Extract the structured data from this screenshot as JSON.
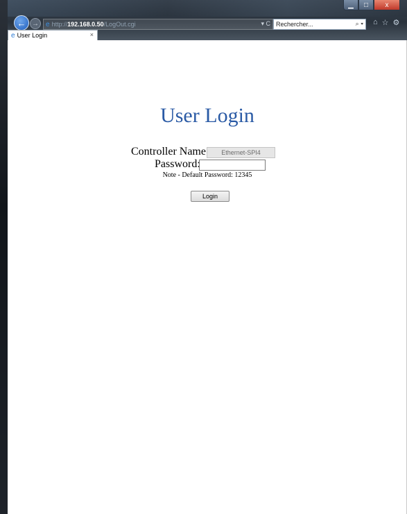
{
  "window": {
    "minimize_glyph": "▁",
    "maximize_glyph": "□",
    "close_glyph": "x"
  },
  "toolbar": {
    "back_glyph": "←",
    "forward_glyph": "→",
    "address_prefix": "http://",
    "address_host": "192.168.0.50",
    "address_path": "/LogOut.cgi",
    "refresh_glyph": "▾ C",
    "search_placeholder": "Rechercher...",
    "search_glyph": "⌕ ▾",
    "home_glyph": "⌂",
    "favorites_glyph": "☆",
    "settings_glyph": "⚙"
  },
  "tab": {
    "title": "User Login",
    "close_glyph": "×"
  },
  "page": {
    "title": "User Login",
    "controller_label": "Controller Name:",
    "controller_value": "Ethernet-SPI4",
    "password_label": "Password:",
    "password_value": "",
    "note": "Note - Default Password: 12345",
    "login_button": "Login"
  },
  "colors": {
    "title": "#2a5aa5",
    "page_background": "#ffffff"
  }
}
